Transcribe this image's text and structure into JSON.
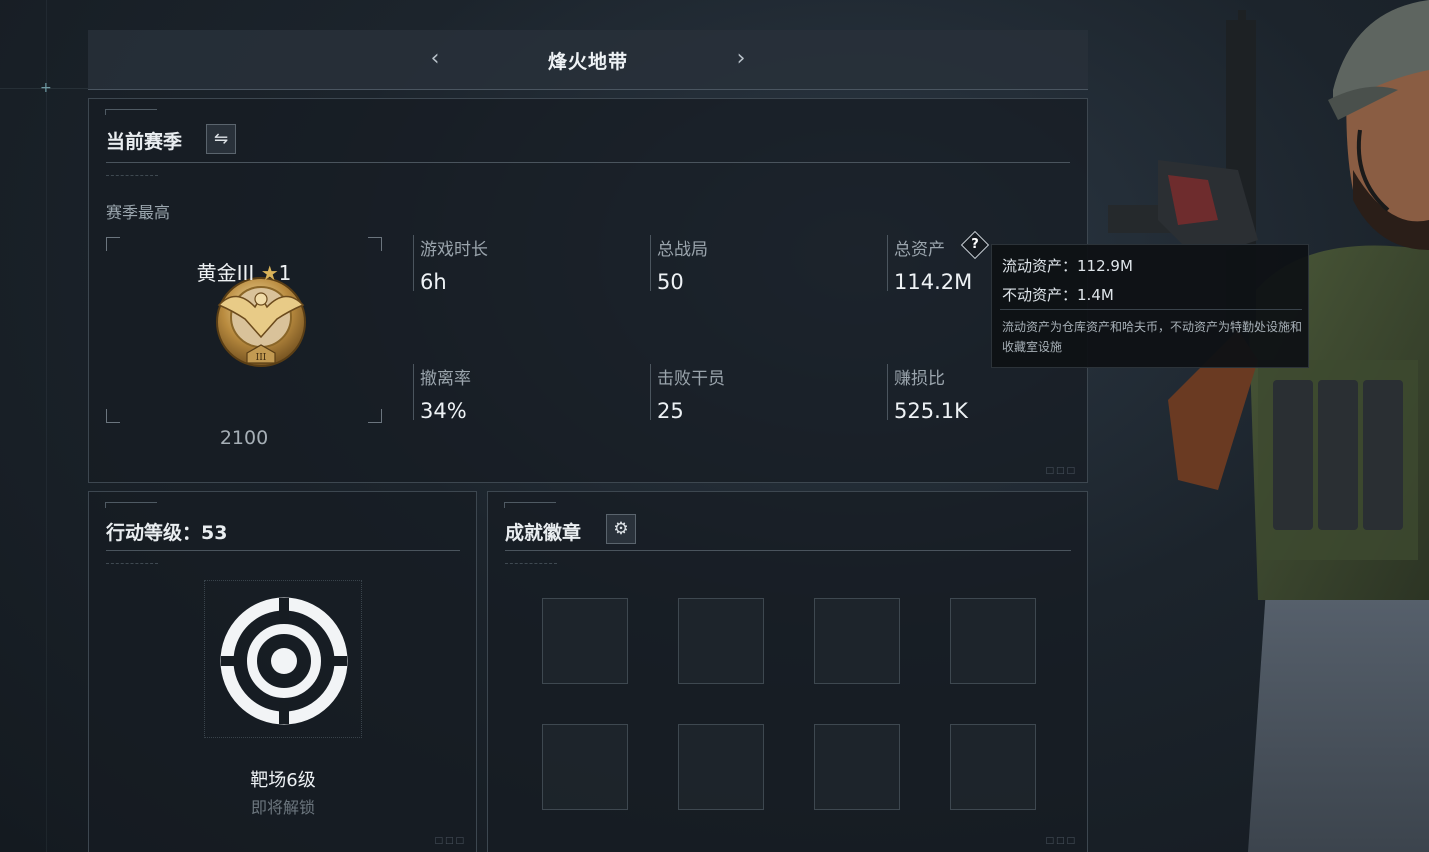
{
  "header": {
    "title": "烽火地带",
    "prev_icon": "chevron-left-icon",
    "next_icon": "chevron-right-icon"
  },
  "season": {
    "title": "当前赛季",
    "swap_icon": "swap-arrows-icon",
    "highest_label": "赛季最高",
    "rank": {
      "name": "黄金III",
      "star_icon": "star-icon",
      "stars": "1",
      "score": "2100",
      "medal_icon": "gold-eagle-medal-icon"
    },
    "stats": [
      {
        "label": "游戏时长",
        "value": "6h"
      },
      {
        "label": "总战局",
        "value": "50"
      },
      {
        "label": "总资产",
        "value": "114.2M",
        "has_help": true
      },
      {
        "label": "撤离率",
        "value": "34%"
      },
      {
        "label": "击败干员",
        "value": "25"
      },
      {
        "label": "赚损比",
        "value": "525.1K"
      }
    ]
  },
  "tooltip": {
    "liquid_label": "流动资产：",
    "liquid_value": "112.9M",
    "fixed_label": "不动资产：",
    "fixed_value": "1.4M",
    "note": "流动资产为仓库资产和哈夫币，不动资产为特勤处设施和收藏室设施"
  },
  "level": {
    "title": "行动等级：",
    "value": "53",
    "target_icon": "target-range-icon",
    "name": "靶场6级",
    "status": "即将解锁"
  },
  "achievements": {
    "title": "成就徽章",
    "settings_icon": "gear-icon",
    "slot_count": 8
  },
  "colors": {
    "gold": "#d9b35a",
    "panel_border": "#3d4750",
    "text_primary": "#eef2f5",
    "text_secondary": "#9aa4ac"
  }
}
